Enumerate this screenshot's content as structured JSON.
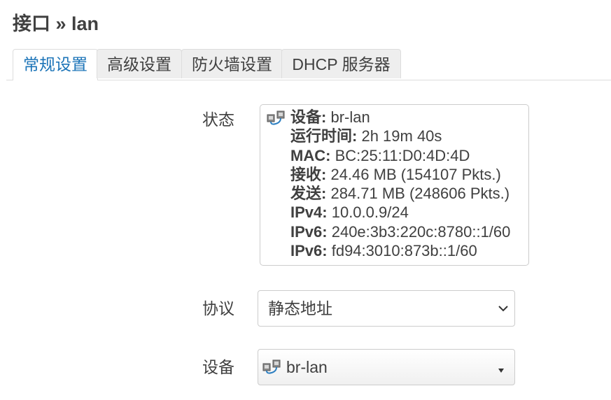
{
  "page": {
    "title": "接口 » lan"
  },
  "tabs": [
    {
      "label": "常规设置",
      "active": true
    },
    {
      "label": "高级设置",
      "active": false
    },
    {
      "label": "防火墙设置",
      "active": false
    },
    {
      "label": "DHCP 服务器",
      "active": false
    }
  ],
  "status": {
    "label": "状态",
    "icon": "ethernet-bridge-icon",
    "rows": [
      {
        "key": "设备:",
        "value": "br-lan"
      },
      {
        "key": "运行时间:",
        "value": "2h 19m 40s"
      },
      {
        "key": "MAC:",
        "value": "BC:25:11:D0:4D:4D"
      },
      {
        "key": "接收:",
        "value": "24.46 MB (154107 Pkts.)"
      },
      {
        "key": "发送:",
        "value": "284.71 MB (248606 Pkts.)"
      },
      {
        "key": "IPv4:",
        "value": "10.0.0.9/24"
      },
      {
        "key": "IPv6:",
        "value": "240e:3b3:220c:8780::1/60"
      },
      {
        "key": "IPv6:",
        "value": "fd94:3010:873b::1/60"
      }
    ]
  },
  "protocol": {
    "label": "协议",
    "value": "静态地址",
    "icon": "chevron-down-icon"
  },
  "device": {
    "label": "设备",
    "value": "br-lan",
    "icon": "ethernet-bridge-icon",
    "dropdown_icon": "triangle-down-icon"
  },
  "colors": {
    "accent": "#1c74b8",
    "text": "#404040",
    "border": "#cccccc",
    "tab_bg": "#eeeeee"
  }
}
